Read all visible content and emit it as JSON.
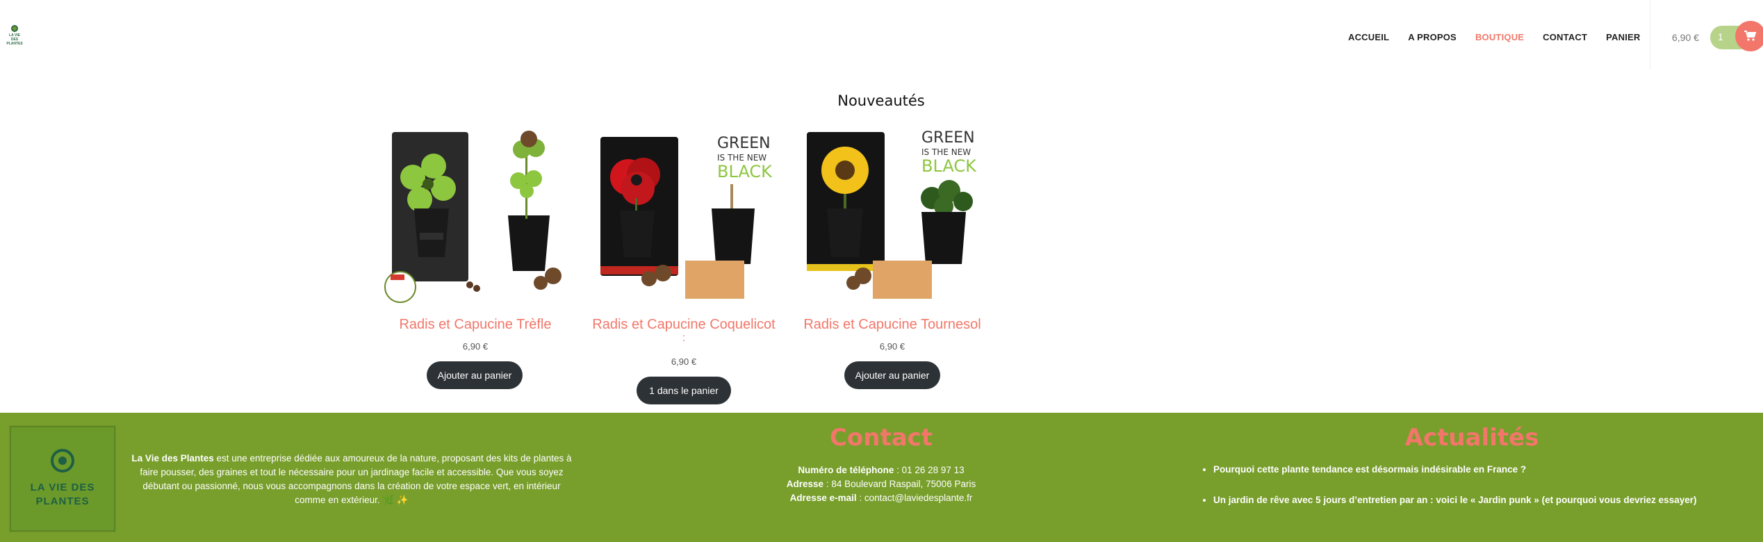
{
  "header": {
    "logo_text": "LA VIE DES PLANTES",
    "nav": [
      "ACCUEIL",
      "A PROPOS",
      "BOUTIQUE",
      "CONTACT",
      "PANIER"
    ],
    "active_nav": "BOUTIQUE",
    "cart_total": "6,90 €",
    "cart_count": "1",
    "cart_icon": "shopping-cart-icon"
  },
  "section": {
    "title": "Nouveautés"
  },
  "products": [
    {
      "name": "Radis et Capucine Trèfle",
      "price": "6,90 €",
      "button": "Ajouter au panier"
    },
    {
      "name": "Radis et Capucine Coquelicot",
      "name_extra": ":",
      "price": "6,90 €",
      "button": "1 dans le panier"
    },
    {
      "name": "Radis et Capucine Tournesol",
      "price": "6,90 €",
      "button": "Ajouter au panier"
    }
  ],
  "footer": {
    "logo_text_1": "LA VIE DES",
    "logo_text_2": "PLANTES",
    "about_brand": "La Vie des Plantes",
    "about_text": " est une entreprise dédiée aux amoureux de la nature, proposant des kits de plantes à faire pousser, des graines et tout le nécessaire pour un jardinage facile et accessible. Que vous soyez débutant ou passionné, nous vous accompagnons dans la création de votre espace vert, en intérieur comme en extérieur. 🌿 ✨",
    "contact_title": "Contact",
    "phone_label": "Numéro de téléphone",
    "phone": " : 01 26 28 97 13",
    "address_label": "Adresse",
    "address": " : 84 Boulevard Raspail, 75006 Paris",
    "email_label": "Adresse e-mail",
    "email": " : contact@laviedesplante.fr",
    "news_title": "Actualités",
    "news": [
      "Pourquoi cette plante tendance est désormais indésirable en France ?",
      "Un jardin de rêve avec 5 jours d’entretien par an : voici le « Jardin punk » (et pourquoi vous devriez essayer)"
    ]
  },
  "colors": {
    "accent": "#f2776a",
    "footer_bg": "#789e2c",
    "button_dark": "#2d3236"
  }
}
